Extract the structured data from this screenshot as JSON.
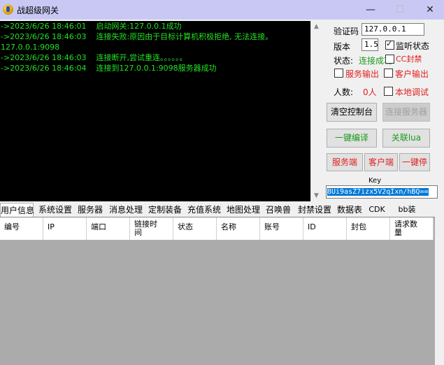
{
  "window": {
    "title": "战超级网关",
    "minimize": "—",
    "maximize": "☐",
    "close": "✕"
  },
  "console": {
    "lines": [
      "->2023/6/26 18:46:01    启动网关:127.0.0.1成功",
      "->2023/6/26 18:46:03    连接失败:原因由于目标计算机积极拒绝, 无法连接。",
      "127.0.0.1:9098",
      "->2023/6/26 18:46:03    连接断开,尝试重连。。。。。。",
      "->2023/6/26 18:46:04    连接到127.0.0.1:9098服务器成功"
    ]
  },
  "panel": {
    "verify_label": "验证码",
    "verify_value": "127.0.0.1",
    "version_label": "版本",
    "version_value": "1.5",
    "monitor_label": "监听状态",
    "status_label": "状态:",
    "status_value": "连接成功",
    "cc_label": "CC封禁",
    "server_out_label": "服务输出",
    "client_out_label": "客户输出",
    "people_label": "人数:",
    "people_value": "0人",
    "local_debug_label": "本地调试",
    "clear_console": "清空控制台",
    "connect_server": "连接服务器",
    "compile": "一键编译",
    "link_lua": "关联lua",
    "server_btn": "服务端",
    "client_btn": "客户端",
    "stop_btn": "一键停",
    "key_label": "Key",
    "key_value": "8Ui9asZ7izx5V2qIxn/hBQ=="
  },
  "colors": {
    "console_text": "#22e222",
    "status_green": "#1a9a1a",
    "red": "#e02020",
    "key_highlight": "#0078d7"
  },
  "tabs": [
    "用户信息",
    "系统设置",
    "服务器",
    "消息处理",
    "定制装备",
    "充值系统",
    "地图处理",
    "召唤兽",
    "封禁设置",
    "数据表",
    "CDK",
    "bb装"
  ],
  "table": {
    "columns": [
      "编号",
      "IP",
      "端口",
      "链接时间",
      "状态",
      "名称",
      "账号",
      "ID",
      "封包",
      "请求数量"
    ]
  }
}
